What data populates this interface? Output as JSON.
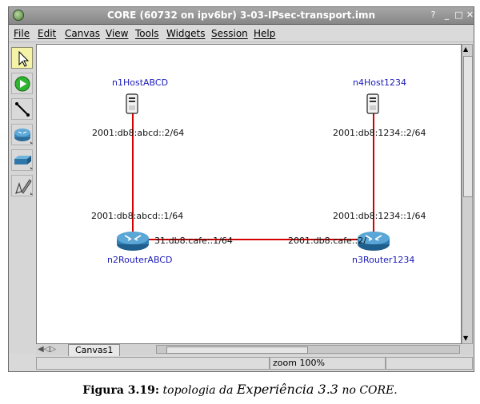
{
  "window": {
    "title": "CORE (60732 on ipv6br) 3-03-IPsec-transport.imn"
  },
  "menu": [
    "File",
    "Edit",
    "Canvas",
    "View",
    "Tools",
    "Widgets",
    "Session",
    "Help"
  ],
  "tools": [
    {
      "name": "select",
      "icon": "pointer-icon"
    },
    {
      "name": "start",
      "icon": "play-icon"
    },
    {
      "name": "link",
      "icon": "link-icon"
    },
    {
      "name": "router",
      "icon": "router-icon"
    },
    {
      "name": "switch",
      "icon": "switch-icon"
    },
    {
      "name": "annotate",
      "icon": "pen-icon"
    }
  ],
  "nodes": {
    "n1": {
      "label": "n1HostABCD",
      "addr": "2001:db8:abcd::2/64"
    },
    "n4": {
      "label": "n4Host1234",
      "addr": "2001:db8:1234::2/64"
    },
    "n2": {
      "label": "n2RouterABCD",
      "addr_top": "2001:db8:abcd::1/64",
      "addr_link": "31:db8:cafe::1/64"
    },
    "n3": {
      "label": "n3Router1234",
      "addr_top": "2001:db8:1234::1/64",
      "addr_link": "2001:db8:cafe::2/"
    }
  },
  "link_color": "#d40000",
  "tab": {
    "label": "Canvas1"
  },
  "status": {
    "zoom": "zoom 100%"
  },
  "caption": {
    "prefix": "Figura 3.19:",
    "text": "topologia da",
    "emph": "Experiência 3.3",
    "suffix": "no CORE."
  }
}
